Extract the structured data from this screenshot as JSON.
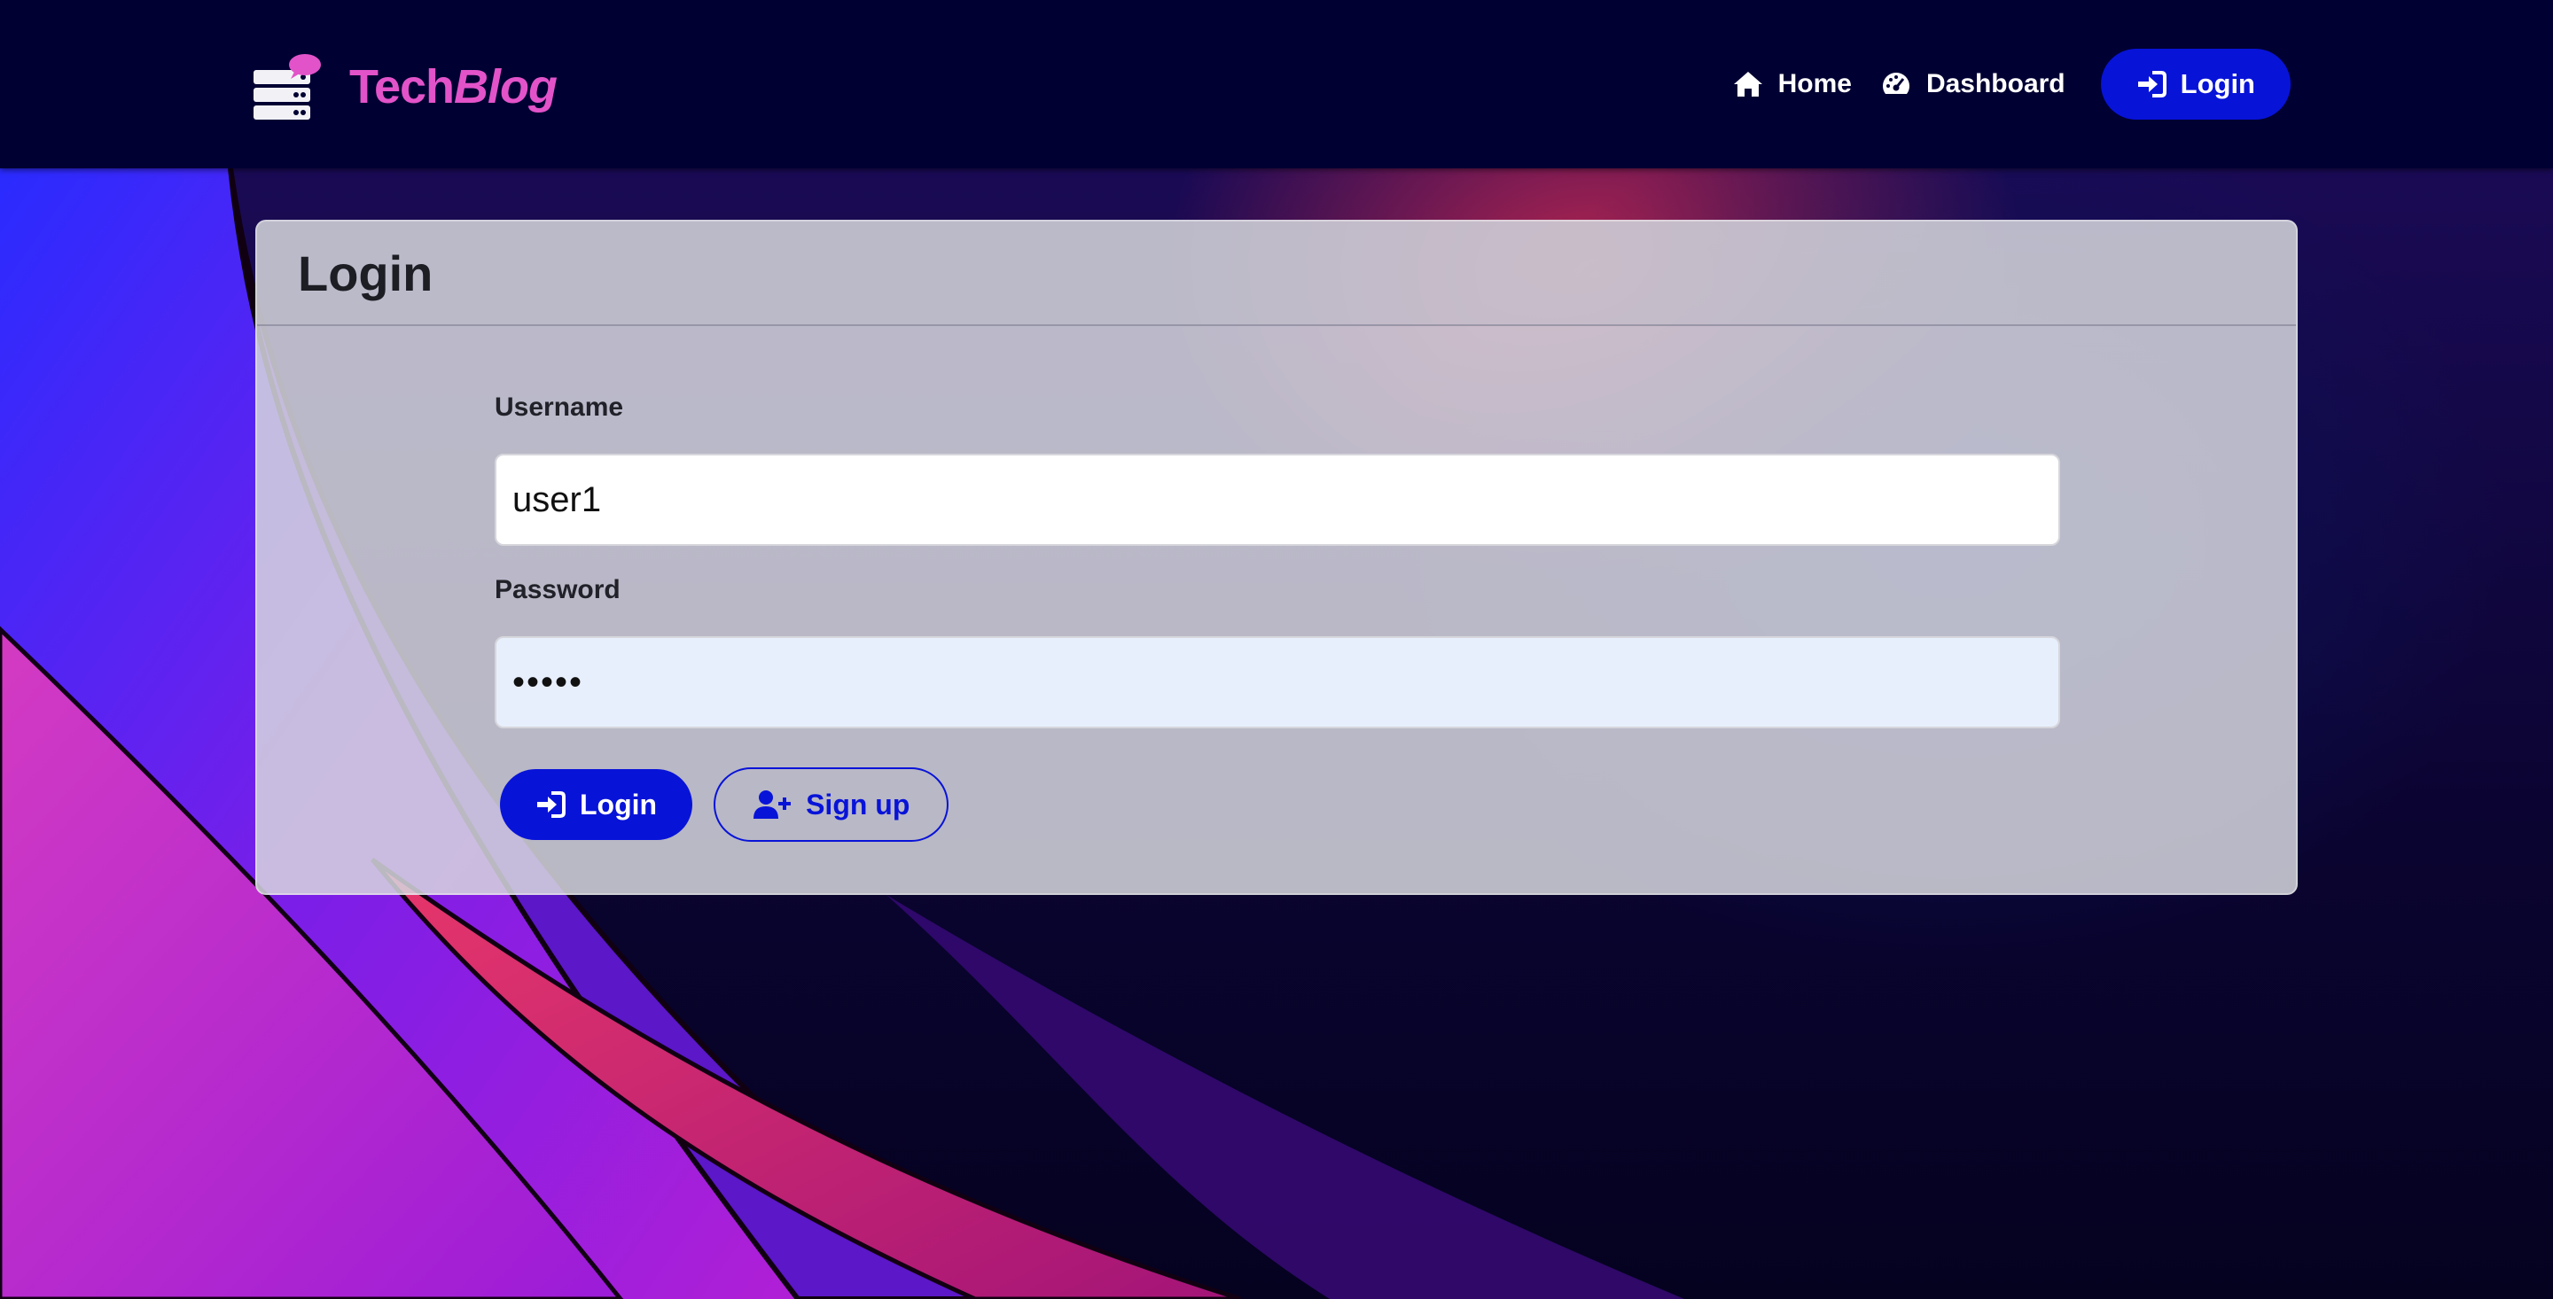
{
  "brand": {
    "name_plain": "Tech",
    "name_italic": "Blog",
    "icon": "server-chat-icon",
    "color": "#e253c9"
  },
  "nav": {
    "home_label": "Home",
    "dashboard_label": "Dashboard",
    "login_label": "Login",
    "home_icon": "home-icon",
    "dashboard_icon": "gauge-icon",
    "login_icon": "sign-in-icon"
  },
  "card": {
    "title": "Login",
    "username_label": "Username",
    "username_value": "user1",
    "password_label": "Password",
    "password_value": "•••••",
    "login_button": "Login",
    "signup_button": "Sign up"
  },
  "colors": {
    "navbar": "#000033",
    "accent": "#0813d8",
    "brand": "#e253c9"
  }
}
